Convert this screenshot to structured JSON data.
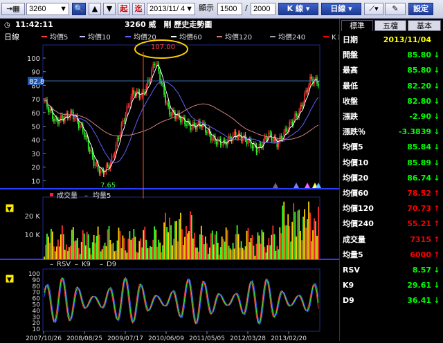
{
  "toolbar": {
    "symbol": "3260",
    "query_btn": "起",
    "query_btn2": "迄",
    "date": "2013/11/ 4",
    "display_label": "顯示",
    "display_count": "1500",
    "separator": "/",
    "total_count": "2000",
    "k_line": "K 線",
    "period": "日線",
    "settings": "設定"
  },
  "chart_header": {
    "time": "11:42:11",
    "title": "3260 威　剛 歷史走勢圖",
    "period_label": "日線",
    "legend": [
      "均價5",
      "均價10",
      "均價20",
      "均價60",
      "均價120",
      "均價240",
      "K 線"
    ],
    "legend_colors": [
      "#ff4040",
      "#c0c0ff",
      "#6060ff",
      "#ffffff",
      "#d08080",
      "#a0a0a0",
      "#ff0000"
    ]
  },
  "price_panel": {
    "y_ticks": [
      "100",
      "90",
      "80",
      "70",
      "60",
      "50",
      "40",
      "30",
      "20",
      "10"
    ],
    "current_value": "82.8",
    "high_label": "107.00",
    "low_label": "7.65"
  },
  "volume_panel": {
    "legend": [
      "成交量",
      "均量5"
    ],
    "y_ticks": [
      "20 K",
      "10 K"
    ]
  },
  "kd_panel": {
    "legend": [
      "RSV",
      "K9",
      "D9"
    ],
    "y_ticks": [
      "100",
      "90",
      "80",
      "70",
      "60",
      "50",
      "40",
      "30",
      "20",
      "10"
    ]
  },
  "x_axis": [
    "2007/10/26",
    "2008/08/25",
    "2009/07/17",
    "2010/06/09",
    "2011/05/05",
    "2012/03/28",
    "2013/02/20"
  ],
  "side": {
    "tabs": [
      "標準",
      "五檔",
      "基本"
    ],
    "rows": [
      {
        "label": "日期",
        "value": "2013/11/04",
        "color": "#ffff00",
        "arrow": ""
      },
      {
        "label": "開盤",
        "value": "85.80",
        "color": "#00ff00",
        "arrow": "↓"
      },
      {
        "label": "最高",
        "value": "85.80",
        "color": "#00ff00",
        "arrow": "↓"
      },
      {
        "label": "最低",
        "value": "82.20",
        "color": "#00ff00",
        "arrow": "↓"
      },
      {
        "label": "收盤",
        "value": "82.80",
        "color": "#00ff00",
        "arrow": "↓"
      },
      {
        "label": "漲跌",
        "value": "-2.90",
        "color": "#00ff00",
        "arrow": "↓"
      },
      {
        "label": "漲跌％",
        "value": "-3.3839",
        "color": "#00ff00",
        "arrow": "↓"
      },
      {
        "label": "均價5",
        "value": "85.84",
        "color": "#00ff00",
        "arrow": "↓"
      },
      {
        "label": "均價10",
        "value": "85.89",
        "color": "#00ff00",
        "arrow": "↓"
      },
      {
        "label": "均價20",
        "value": "86.74",
        "color": "#00ff00",
        "arrow": "↓"
      },
      {
        "label": "均價60",
        "value": "78.52",
        "color": "#ff0000",
        "arrow": "↑"
      },
      {
        "label": "均價120",
        "value": "70.73",
        "color": "#ff0000",
        "arrow": "↑"
      },
      {
        "label": "均價240",
        "value": "55.21",
        "color": "#ff0000",
        "arrow": "↑"
      },
      {
        "label": "成交量",
        "value": "7315",
        "color": "#ff0000",
        "arrow": "↑"
      },
      {
        "label": "均量5",
        "value": "6000",
        "color": "#ff0000",
        "arrow": "↑"
      },
      {
        "label": "RSV",
        "value": "8.57",
        "color": "#00ff00",
        "arrow": "↓"
      },
      {
        "label": "K9",
        "value": "29.61",
        "color": "#00ff00",
        "arrow": "↓"
      },
      {
        "label": "D9",
        "value": "36.41",
        "color": "#00ff00",
        "arrow": "↓"
      }
    ]
  }
}
